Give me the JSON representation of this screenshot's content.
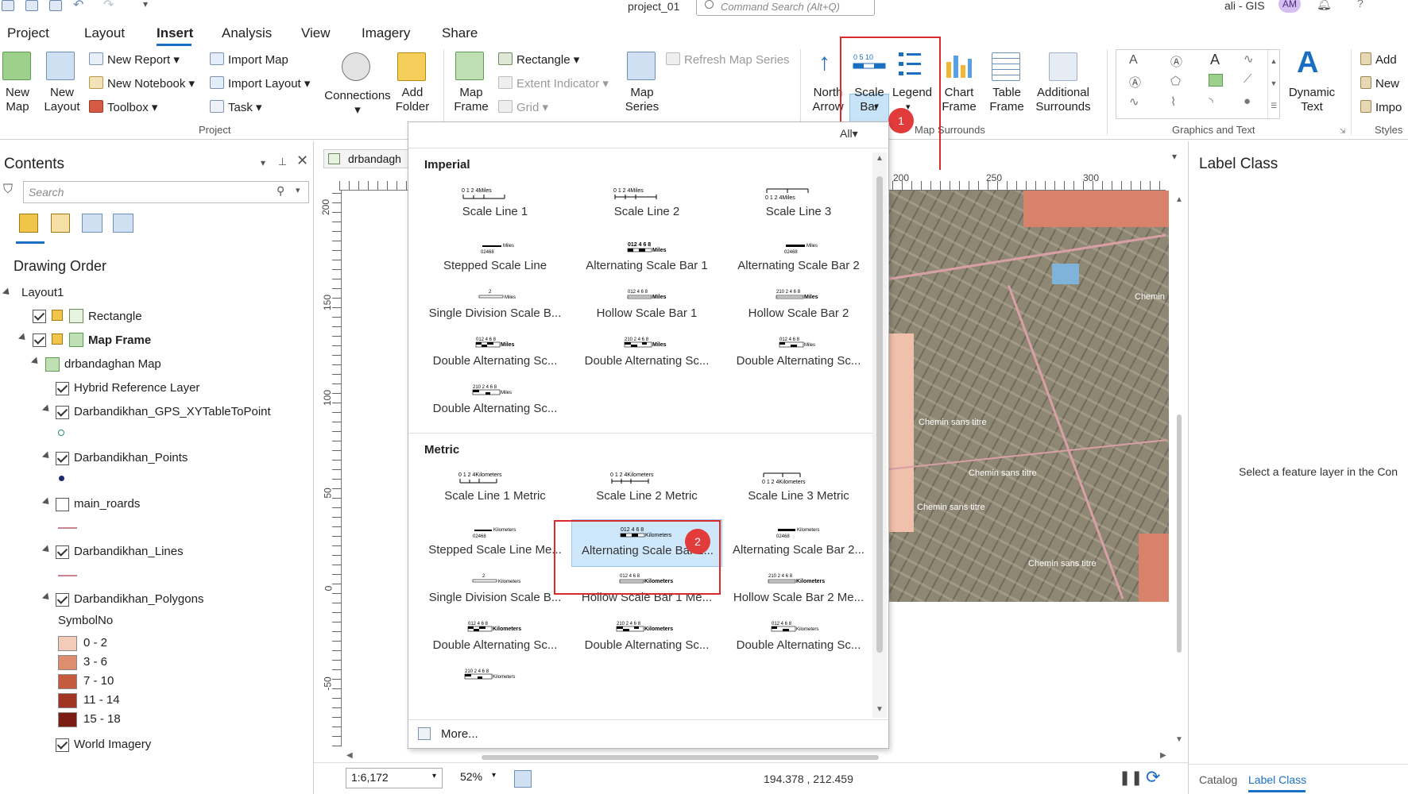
{
  "titlebar": {
    "project_name": "project_01",
    "search_placeholder": "Command Search (Alt+Q)",
    "user": "ali - GIS",
    "avatar_initials": "AM"
  },
  "menu_tabs": [
    "Project",
    "Layout",
    "Insert",
    "Analysis",
    "View",
    "Imagery",
    "Share"
  ],
  "ribbon": {
    "project_group": {
      "label": "Project",
      "new_map": "New\nMap",
      "new_layout": "New\nLayout",
      "new_report": "New Report",
      "new_notebook": "New Notebook",
      "toolbox": "Toolbox",
      "import_map": "Import Map",
      "import_layout": "Import Layout",
      "task": "Task",
      "connections": "Connections",
      "add_folder": "Add\nFolder"
    },
    "frame_group": {
      "map_frame": "Map\nFrame",
      "rectangle": "Rectangle",
      "extent_indicator": "Extent Indicator",
      "grid": "Grid",
      "map_series": "Map\nSeries",
      "refresh_map_series": "Refresh Map Series"
    },
    "surrounds_group": {
      "label": "Map Surrounds",
      "north_arrow": "North\nArrow",
      "scale_bar": "Scale\nBar",
      "legend": "Legend",
      "chart_frame": "Chart\nFrame",
      "table_frame": "Table\nFrame",
      "additional_surrounds": "Additional\nSurrounds"
    },
    "graphics_group": {
      "label": "Graphics and Text",
      "dynamic_text": "Dynamic\nText"
    },
    "styles_group": {
      "label": "Styles",
      "add": "Add",
      "new": "New",
      "import": "Impo"
    }
  },
  "contents": {
    "title": "Contents",
    "search_placeholder": "Search",
    "drawing_order": "Drawing Order",
    "layers": [
      {
        "name": "Layout1",
        "checked": null
      },
      {
        "name": "Rectangle",
        "checked": true
      },
      {
        "name": "Map Frame",
        "checked": true
      },
      {
        "name": "drbandaghan Map",
        "checked": null
      },
      {
        "name": "Hybrid Reference Layer",
        "checked": true
      },
      {
        "name": "Darbandikhan_GPS_XYTableToPoint",
        "checked": true
      },
      {
        "name": "Darbandikhan_Points",
        "checked": true
      },
      {
        "name": "main_roards",
        "checked": false
      },
      {
        "name": "Darbandikhan_Lines",
        "checked": true
      },
      {
        "name": "Darbandikhan_Polygons",
        "checked": true
      },
      {
        "name": "World Imagery",
        "checked": true
      }
    ],
    "legend_field": "SymbolNo",
    "legend_classes": [
      {
        "label": "0 - 2",
        "color": "#f2cbb9"
      },
      {
        "label": "3 - 6",
        "color": "#de8d6e"
      },
      {
        "label": "7 - 10",
        "color": "#c55a3e"
      },
      {
        "label": "11 - 14",
        "color": "#a23423"
      },
      {
        "label": "15 - 18",
        "color": "#7a1c14"
      }
    ]
  },
  "layout_view": {
    "tab_title": "drbandagh",
    "ruler_top_labels": [
      "200",
      "250",
      "300"
    ],
    "ruler_left_labels": [
      "200",
      "150",
      "100",
      "50",
      "0",
      "-50"
    ],
    "map_labels": [
      "Chemin sans titre",
      "Chemin sans titre",
      "Chemin sans titre",
      "Chemin sans titre",
      "Chemin"
    ],
    "status": {
      "scale": "1:6,172",
      "zoom": "52%",
      "coordinates": "194.378 , 212.459"
    }
  },
  "gallery": {
    "filter": "All",
    "sections": [
      {
        "title": "Imperial",
        "items": [
          "Scale Line 1",
          "Scale Line 2",
          "Scale Line 3",
          "Stepped Scale Line",
          "Alternating Scale Bar 1",
          "Alternating Scale Bar 2",
          "Single Division Scale B...",
          "Hollow Scale Bar 1",
          "Hollow Scale Bar 2",
          "Double Alternating Sc...",
          "Double Alternating Sc...",
          "Double Alternating Sc...",
          "Double Alternating Sc..."
        ],
        "unit": "Miles"
      },
      {
        "title": "Metric",
        "items": [
          "Scale Line 1 Metric",
          "Scale Line 2 Metric",
          "Scale Line 3 Metric",
          "Stepped Scale Line Me...",
          "Alternating Scale Bar 1...",
          "Alternating Scale Bar 2...",
          "Single Division Scale B...",
          "Hollow Scale Bar 1 Me...",
          "Hollow Scale Bar 2 Me...",
          "Double Alternating Sc...",
          "Double Alternating Sc...",
          "Double Alternating Sc..."
        ],
        "unit": "Kilometers"
      }
    ],
    "more": "More..."
  },
  "badges": [
    "1",
    "2"
  ],
  "right_pane": {
    "title": "Label Class",
    "message": "Select a feature layer in the Con",
    "tabs": [
      "Catalog",
      "Label Class"
    ]
  },
  "colors": {
    "accent": "#1b6fc2",
    "highlight": "#c7e3f8",
    "callout_red": "#d92b2b"
  }
}
